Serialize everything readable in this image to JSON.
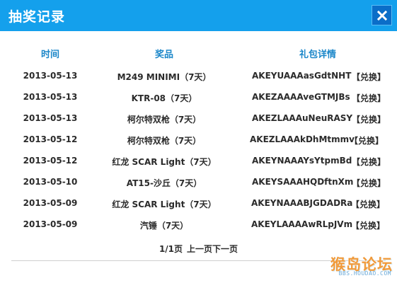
{
  "dialog": {
    "title": "抽奖记录"
  },
  "table": {
    "headers": [
      "时间",
      "奖品",
      "礼包详情"
    ],
    "rows": [
      {
        "date": "2013-05-13",
        "prize": "M249 MINIMI（7天）",
        "code": "AKEYUAAAasGdtNHT",
        "action": "【兑换】"
      },
      {
        "date": "2013-05-13",
        "prize": "KTR-08（7天）",
        "code": "AKEZAAAAveGTMJBs",
        "action": "【兑换】"
      },
      {
        "date": "2013-05-13",
        "prize": "柯尔特双枪（7天）",
        "code": "AKEZLAAAuNeuRASY",
        "action": "【兑换】"
      },
      {
        "date": "2013-05-12",
        "prize": "柯尔特双枪（7天）",
        "code": "AKEZLAAAkDhMtmmv",
        "action": "【兑换】"
      },
      {
        "date": "2013-05-12",
        "prize": "红龙 SCAR Light（7天）",
        "code": "AKEYNAAAYsYtpmBd",
        "action": "【兑换】"
      },
      {
        "date": "2013-05-10",
        "prize": "AT15-沙丘（7天）",
        "code": "AKEYSAAAHQDftnXm",
        "action": "【兑换】"
      },
      {
        "date": "2013-05-09",
        "prize": "红龙 SCAR Light（7天）",
        "code": "AKEYNAAABJGDADRa",
        "action": "【兑换】"
      },
      {
        "date": "2013-05-09",
        "prize": "汽锤（7天）",
        "code": "AKEYLAAAAwRLpJVm",
        "action": "【兑换】"
      }
    ]
  },
  "pager": {
    "page_info": "1/1页",
    "prev": "上一页",
    "next": "下一页"
  },
  "watermark": {
    "main": "猴岛论坛",
    "sub": "BBS.HOUDAO.COM"
  },
  "colors": {
    "titlebar": "#14a0ec",
    "close_button": "#0b6ec8",
    "header_text": "#1c87c9"
  },
  "icons": {
    "close": "close-icon"
  }
}
